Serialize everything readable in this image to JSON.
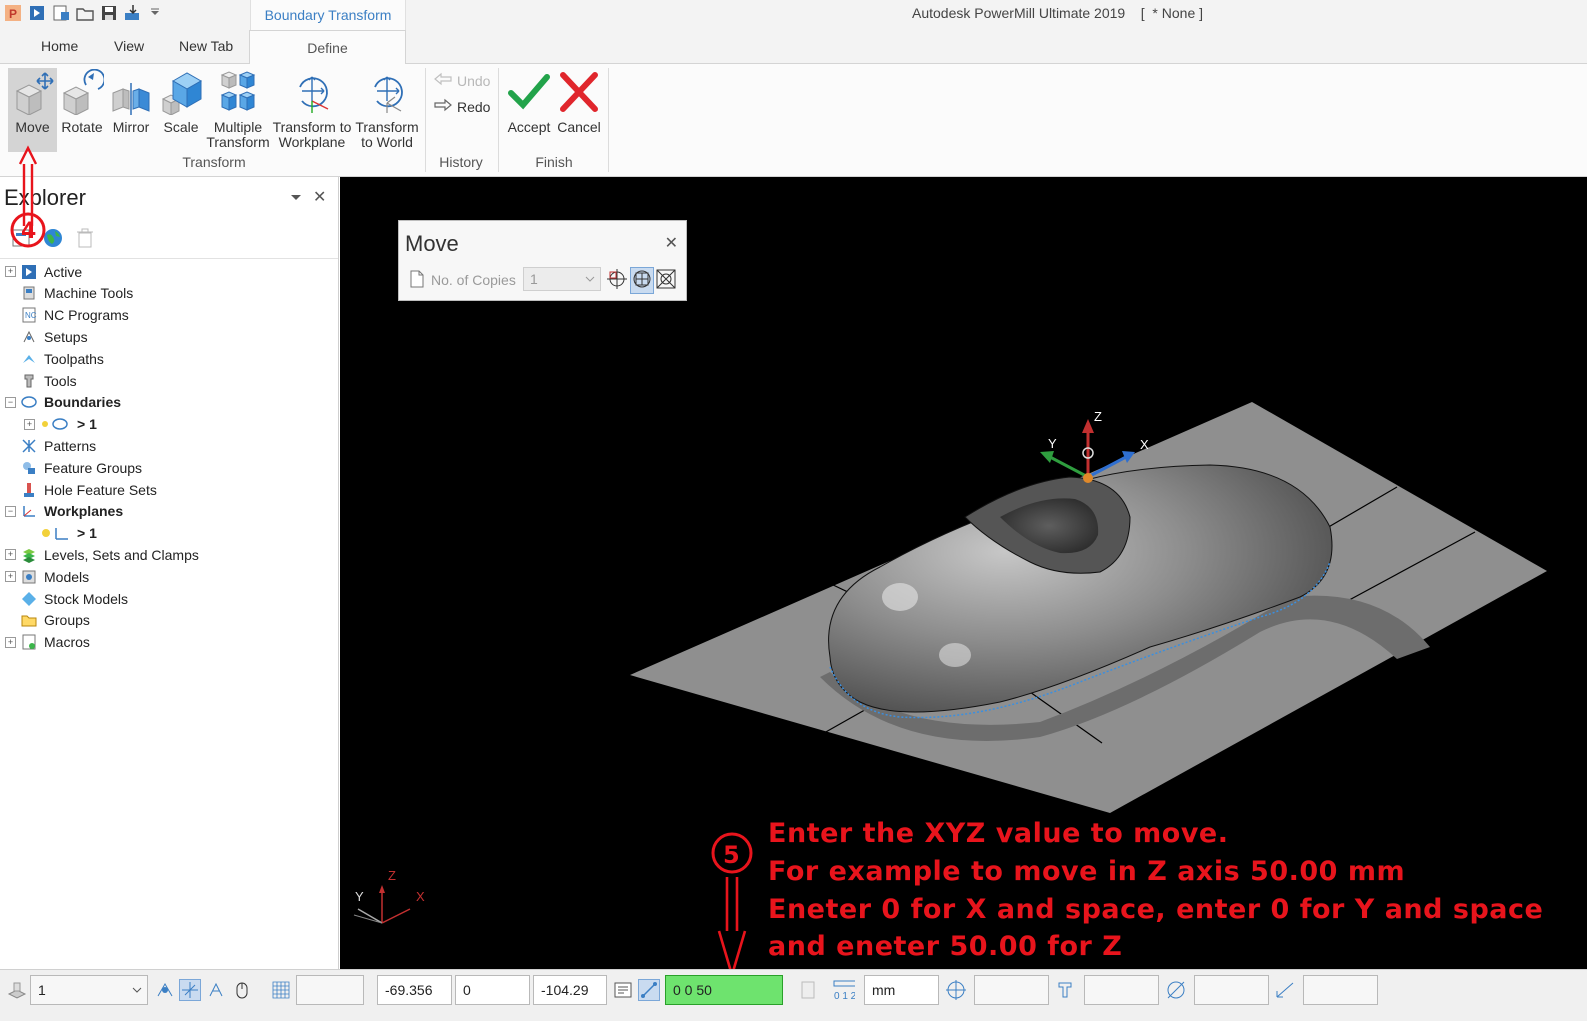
{
  "app": {
    "context_tab_title": "Boundary Transform",
    "window_title": "Autodesk PowerMill Ultimate 2019    [  * None ]"
  },
  "tabs": [
    {
      "label": "Home"
    },
    {
      "label": "View"
    },
    {
      "label": "New Tab"
    },
    {
      "label": "Define",
      "active": true
    }
  ],
  "ribbon": {
    "transform": {
      "group_label": "Transform",
      "buttons": [
        {
          "label": "Move",
          "icon": "move-icon",
          "selected": true
        },
        {
          "label": "Rotate",
          "icon": "rotate-icon"
        },
        {
          "label": "Mirror",
          "icon": "mirror-icon"
        },
        {
          "label": "Scale",
          "icon": "scale-icon"
        },
        {
          "label": "Multiple\nTransform",
          "icon": "multiple-transform-icon"
        },
        {
          "label": "Transform to\nWorkplane",
          "icon": "transform-to-workplane-icon"
        },
        {
          "label": "Transform\nto World",
          "icon": "transform-to-world-icon"
        }
      ]
    },
    "history": {
      "group_label": "History",
      "undo": "Undo",
      "redo": "Redo"
    },
    "finish": {
      "group_label": "Finish",
      "accept": "Accept",
      "cancel": "Cancel"
    }
  },
  "explorer": {
    "title": "Explorer",
    "items": [
      {
        "label": "Active",
        "expandable": true,
        "bold": false,
        "icon": "active-icon"
      },
      {
        "label": "Machine Tools",
        "expandable": false,
        "icon": "machine-tools-icon"
      },
      {
        "label": "NC Programs",
        "expandable": false,
        "icon": "nc-programs-icon"
      },
      {
        "label": "Setups",
        "expandable": false,
        "icon": "setups-icon"
      },
      {
        "label": "Toolpaths",
        "expandable": false,
        "icon": "toolpaths-icon"
      },
      {
        "label": "Tools",
        "expandable": false,
        "icon": "tools-icon"
      },
      {
        "label": "Boundaries",
        "expandable": true,
        "expanded": true,
        "bold": true,
        "icon": "boundaries-icon"
      },
      {
        "label": "> 1",
        "child": true,
        "expandable": true,
        "icon": "boundary-item-icon"
      },
      {
        "label": "Patterns",
        "expandable": false,
        "icon": "patterns-icon"
      },
      {
        "label": "Feature Groups",
        "expandable": false,
        "icon": "feature-groups-icon"
      },
      {
        "label": "Hole Feature Sets",
        "expandable": false,
        "icon": "hole-feature-sets-icon"
      },
      {
        "label": "Workplanes",
        "expandable": true,
        "expanded": true,
        "bold": true,
        "icon": "workplanes-icon"
      },
      {
        "label": "> 1",
        "child": true,
        "expandable": false,
        "icon": "workplane-item-icon"
      },
      {
        "label": "Levels, Sets and Clamps",
        "expandable": true,
        "icon": "levels-icon"
      },
      {
        "label": "Models",
        "expandable": true,
        "icon": "models-icon"
      },
      {
        "label": "Stock Models",
        "expandable": false,
        "icon": "stock-models-icon"
      },
      {
        "label": "Groups",
        "expandable": false,
        "icon": "groups-icon"
      },
      {
        "label": "Macros",
        "expandable": true,
        "icon": "macros-icon"
      }
    ]
  },
  "move_dialog": {
    "title": "Move",
    "copies_label": "No. of Copies",
    "copies_value": "1"
  },
  "viewport": {
    "axis_labels": {
      "z": "Z",
      "y": "Y",
      "x": "X"
    }
  },
  "annotations": {
    "step4": "4",
    "step5": "5",
    "instructions": [
      "Enter the XYZ value to move.",
      "For example to move in Z axis 50.00 mm",
      "Eneter 0 for X and space, enter 0 for Y and space",
      "and eneter 50.00 for Z"
    ],
    "color": "#e8141c"
  },
  "statusbar": {
    "level_select": "1",
    "x": "-69.356",
    "y": "0",
    "z": "-104.29",
    "xyz_input": "0 0 50",
    "units": "mm"
  }
}
